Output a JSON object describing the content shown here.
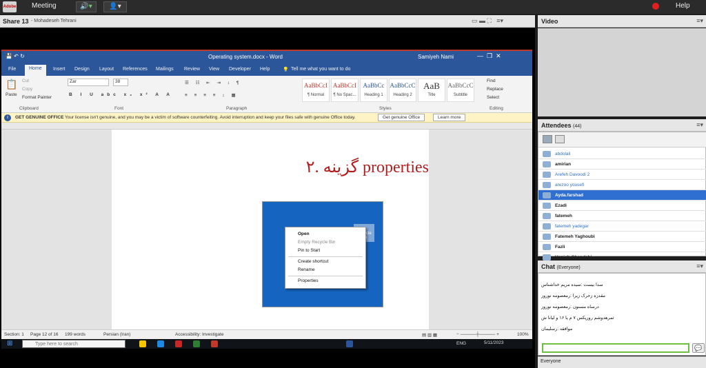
{
  "topbar": {
    "logo_text": "Adobe",
    "meeting_label": "Meeting",
    "help_label": "Help",
    "audio_icon": "speaker-icon",
    "camera_icon": "user-icon"
  },
  "share_pod": {
    "title": "Share 13",
    "presenter": "- Mohadeseh Tehrani"
  },
  "word": {
    "doc_title": "Operating system.docx - Word",
    "user": "Samiyeh Nami",
    "tabs": [
      "File",
      "Home",
      "Insert",
      "Design",
      "Layout",
      "References",
      "Mailings",
      "Review",
      "View",
      "Developer",
      "Help"
    ],
    "tell_me": "Tell me what you want to do",
    "ribbon": {
      "paste": "Paste",
      "cut": "Cut",
      "copy": "Copy",
      "format_painter": "Format Painter",
      "font_name": "Zar",
      "font_size": "38",
      "styles": [
        {
          "sample": "AaBbCcI",
          "name": "¶ Normal"
        },
        {
          "sample": "AaBbCcI",
          "name": "¶ No Spac..."
        },
        {
          "sample": "AaBbCc",
          "name": "Heading 1"
        },
        {
          "sample": "AaBbCcC",
          "name": "Heading 2"
        },
        {
          "sample": "AaB",
          "name": "Title"
        },
        {
          "sample": "AaBbCcC",
          "name": "Subtitle"
        }
      ],
      "find": "Find",
      "replace": "Replace",
      "select": "Select",
      "groups": {
        "clipboard": "Clipboard",
        "font": "Font",
        "paragraph": "Paragraph",
        "styles": "Styles",
        "editing": "Editing"
      }
    },
    "genuine": {
      "title": "GET GENUINE OFFICE",
      "message": "Your license isn't genuine, and you may be a victim of software counterfeiting. Avoid interruption and keep your files safe with genuine Office today.",
      "btn_get": "Get genuine Office",
      "btn_learn": "Learn more"
    },
    "document": {
      "heading": "۲. گزینه properties",
      "recycle_label": "Recycle Bin",
      "context_menu": [
        "Open",
        "Empty Recycle Bin",
        "Pin to Start",
        "Create shortcut",
        "Rename",
        "Properties"
      ]
    },
    "status": {
      "section": "Section: 1",
      "page": "Page 12 of 16",
      "words": "199 words",
      "language": "Persian (Iran)",
      "accessibility": "Accessibility: Investigate",
      "zoom": "100%"
    },
    "taskbar": {
      "search_placeholder": "Type here to search",
      "lang": "ENG",
      "date": "5/11/2023"
    }
  },
  "video_pod": {
    "title": "Video"
  },
  "attendees_pod": {
    "title": "Attendees",
    "count": "(44)",
    "list": [
      {
        "name": "abdolali",
        "style": "blue"
      },
      {
        "name": "amirian",
        "style": "bold"
      },
      {
        "name": "Arefeh Davoodi 2",
        "style": "blue"
      },
      {
        "name": "arezoo yousefi",
        "style": "blue"
      },
      {
        "name": "Ayda.farshad",
        "style": "sel"
      },
      {
        "name": "Ezadi",
        "style": "bold"
      },
      {
        "name": "fatemeh",
        "style": "bold"
      },
      {
        "name": "fatemeh yadegar",
        "style": "blue"
      },
      {
        "name": "Fatemeh Yaghoubi",
        "style": "bold"
      },
      {
        "name": "Fazli",
        "style": "bold"
      },
      {
        "name": "Hanieh Ghandchi",
        "style": "bold"
      }
    ]
  },
  "chat_pod": {
    "title": "Chat",
    "scope": "(Everyone)",
    "messages": [
      "سدا بیست :سیده مریم خداشناس",
      "مقدزه زحرک زیرا :رمعصومه نوروز",
      "درساه مسنون :رمعصومه نوروز",
      "ثمرهدوشم رورپکس ۷ م پا ۱۶ و لیانا ش",
      "موافقه :رسلیمان"
    ],
    "everyone_btn": "Everyone"
  }
}
